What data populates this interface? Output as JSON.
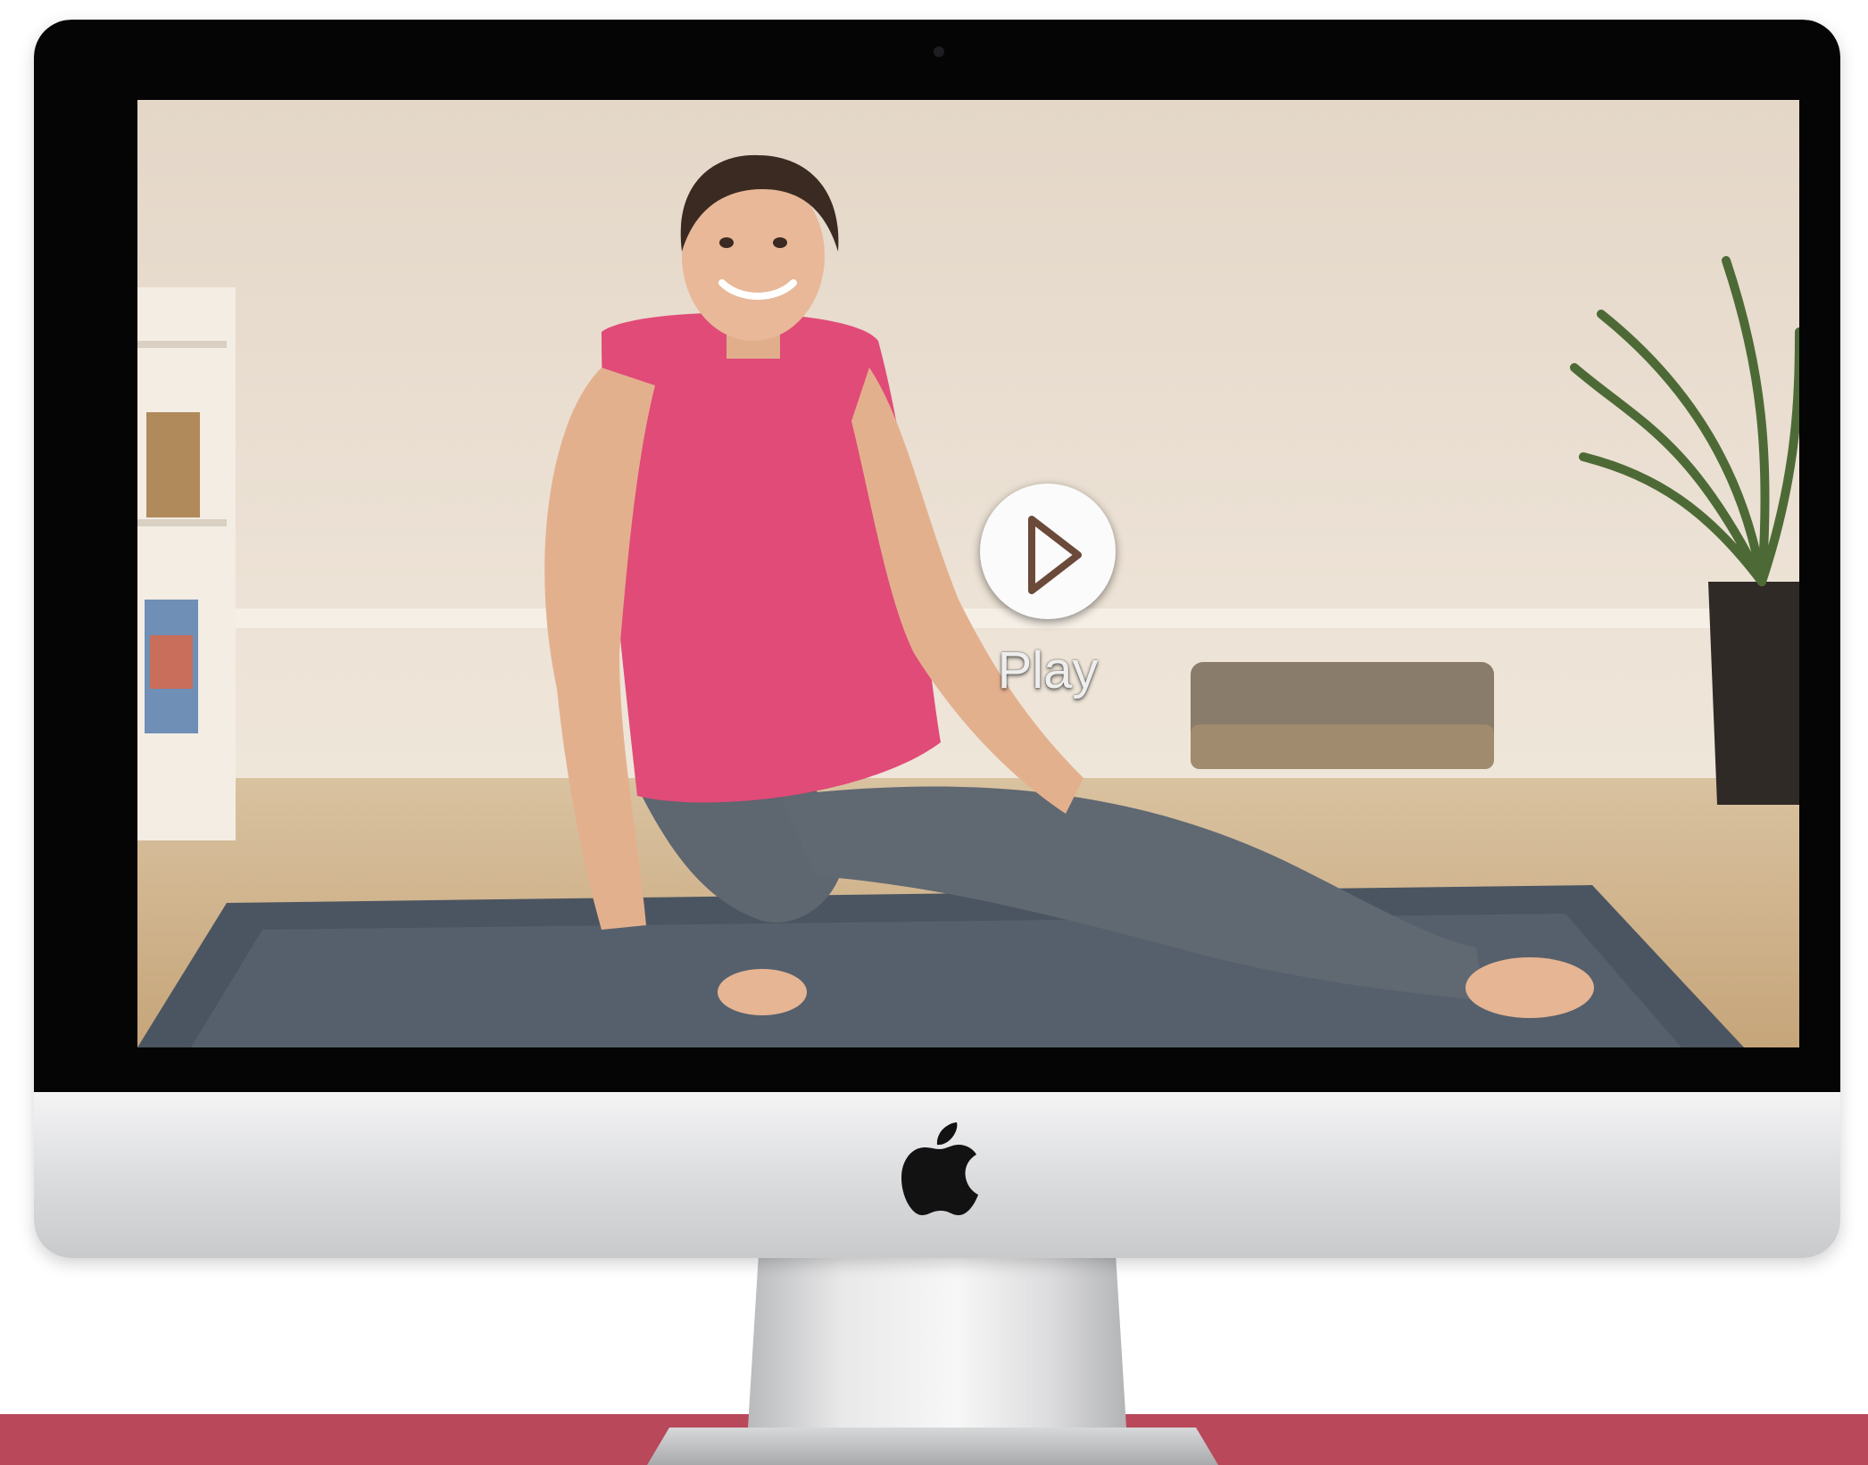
{
  "video": {
    "play_label": "Play",
    "is_playing": false
  },
  "colors": {
    "brand_band": "#b9485a",
    "bezel": "#050505",
    "chin": "#d9dadc"
  },
  "icons": {
    "play": "play-icon",
    "brand": "apple-logo-icon"
  }
}
